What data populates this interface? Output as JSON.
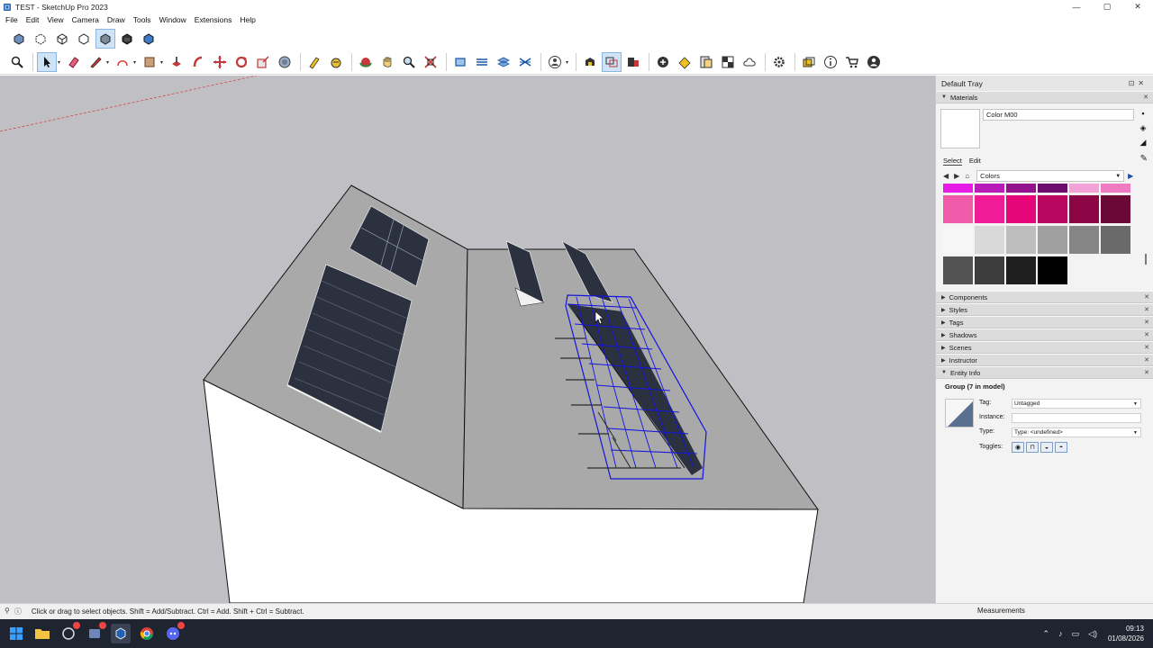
{
  "window": {
    "title": "TEST - SketchUp Pro 2023",
    "minimize": "—",
    "maximize": "▢",
    "close": "✕"
  },
  "menu": [
    "File",
    "Edit",
    "View",
    "Camera",
    "Draw",
    "Tools",
    "Window",
    "Extensions",
    "Help"
  ],
  "tray": {
    "title": "Default Tray",
    "materials": {
      "header": "Materials",
      "name": "Color M00",
      "tab_select": "Select",
      "tab_edit": "Edit",
      "library": "Colors",
      "palette": [
        [
          "#e61be6",
          "#b81bb8",
          "#93138e",
          "#6d0c6e",
          "#f3a2d8",
          "#f07ac2"
        ],
        [
          "#f05aa8",
          "#f01b96",
          "#e6067a",
          "#b8075e",
          "#8c0646",
          "#6a0836"
        ],
        [
          "#f6f6f6",
          "#d9d9d9",
          "#bdbdbd",
          "#a0a0a0",
          "#868686",
          "#6a6a6a"
        ],
        [
          "#535353",
          "#3d3d3d",
          "#1f1f1f",
          "#000000"
        ]
      ]
    },
    "panels": [
      "Components",
      "Styles",
      "Tags",
      "Shadows",
      "Scenes",
      "Instructor",
      "Entity Info"
    ],
    "entity": {
      "title": "Group (7 in model)",
      "tag_label": "Tag:",
      "tag_value": "Untagged",
      "instance_label": "Instance:",
      "instance_value": "",
      "type_label": "Type:",
      "type_value": "Type: <undefined>",
      "toggles_label": "Toggles:"
    }
  },
  "status": {
    "hint": "Click or drag to select objects. Shift = Add/Subtract. Ctrl = Add. Shift + Ctrl = Subtract.",
    "measurements_label": "Measurements"
  },
  "taskbar": {
    "time": "09:13",
    "date": "01/08/2026"
  },
  "colors": {
    "viewport_bg": "#c0c0c4",
    "roof": "#a8a8a8",
    "wall": "#ffffff",
    "panel": "#2c3140",
    "selection": "#1414e0"
  }
}
